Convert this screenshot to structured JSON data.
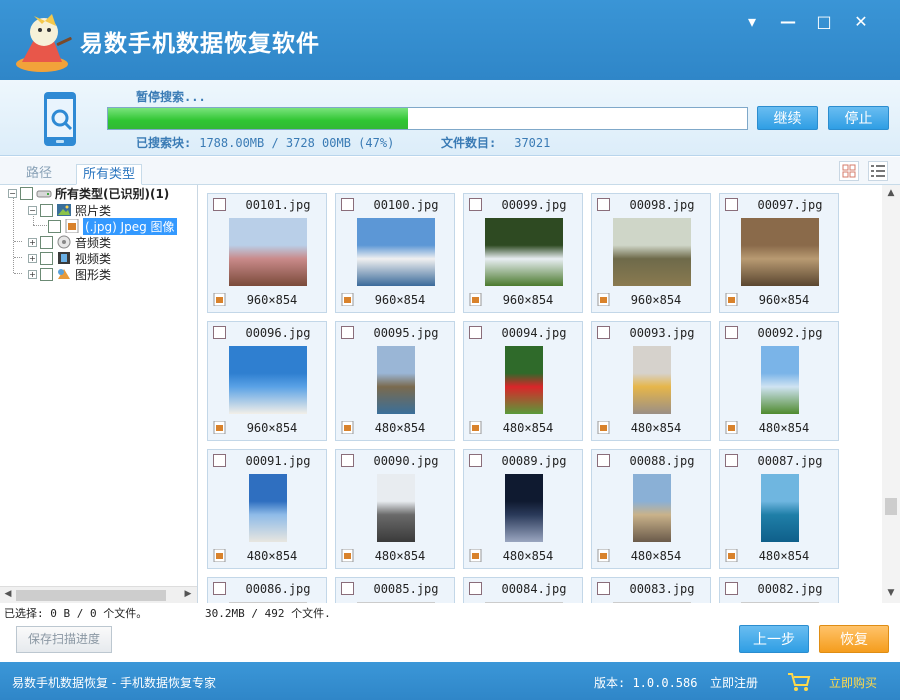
{
  "titlebar": {
    "title": "易数手机数据恢复软件",
    "menu_glyph": "▾",
    "minimize_glyph": "—",
    "maximize_glyph": "□",
    "close_glyph": "✕"
  },
  "progress": {
    "status": "暂停搜索...",
    "percent": 47,
    "resume_label": "继续",
    "stop_label": "停止",
    "searched_label": "已搜索块:",
    "searched_value": "1788.00MB / 3728 00MB (47%)",
    "file_count_label": "文件数目:",
    "file_count_value": "37021"
  },
  "tabs": [
    {
      "label": "路径"
    },
    {
      "label": "所有类型"
    }
  ],
  "tree": {
    "root": "所有类型(已识别)(1)",
    "photos": "照片类",
    "jpeg": "(.jpg) Jpeg 图像",
    "audio": "音频类",
    "video": "视频类",
    "graphics": "图形类"
  },
  "files": [
    {
      "name": "00101.jpg",
      "dim": "960×854",
      "portrait": false,
      "colors": [
        "#b9cfe8",
        "#c98a8a",
        "#7a4a3a"
      ]
    },
    {
      "name": "00100.jpg",
      "dim": "960×854",
      "portrait": false,
      "colors": [
        "#5c97d6",
        "#f0f0f0",
        "#3a6a9a"
      ]
    },
    {
      "name": "00099.jpg",
      "dim": "960×854",
      "portrait": false,
      "colors": [
        "#2e4a22",
        "#e8eef2",
        "#4b7a2e"
      ]
    },
    {
      "name": "00098.jpg",
      "dim": "960×854",
      "portrait": false,
      "colors": [
        "#cfd6c8",
        "#6e6a4a",
        "#8a7a50"
      ]
    },
    {
      "name": "00097.jpg",
      "dim": "960×854",
      "portrait": false,
      "colors": [
        "#8a6a4a",
        "#b89a72",
        "#5a4630"
      ]
    },
    {
      "name": "00096.jpg",
      "dim": "960×854",
      "portrait": false,
      "colors": [
        "#2f7fd0",
        "#5aa2e6",
        "#f2efe8"
      ]
    },
    {
      "name": "00095.jpg",
      "dim": "480×854",
      "portrait": true,
      "colors": [
        "#9ab6d6",
        "#7a6a4e",
        "#3a6f9a"
      ]
    },
    {
      "name": "00094.jpg",
      "dim": "480×854",
      "portrait": true,
      "colors": [
        "#2f6a2a",
        "#d9262a",
        "#5a9a3a"
      ]
    },
    {
      "name": "00093.jpg",
      "dim": "480×854",
      "portrait": true,
      "colors": [
        "#d6d2cc",
        "#e6b64a",
        "#9a8f86"
      ]
    },
    {
      "name": "00092.jpg",
      "dim": "480×854",
      "portrait": true,
      "colors": [
        "#7ab4e8",
        "#cfe3f2",
        "#4f8a2e"
      ]
    },
    {
      "name": "00091.jpg",
      "dim": "480×854",
      "portrait": true,
      "colors": [
        "#2f6fc0",
        "#8fbbe8",
        "#e8e6e0"
      ]
    },
    {
      "name": "00090.jpg",
      "dim": "480×854",
      "portrait": true,
      "colors": [
        "#e8ecf0",
        "#6a6a6a",
        "#3a3a3a"
      ]
    },
    {
      "name": "00089.jpg",
      "dim": "480×854",
      "portrait": true,
      "colors": [
        "#0f1a30",
        "#2a3a5a",
        "#9aa6c0"
      ]
    },
    {
      "name": "00088.jpg",
      "dim": "480×854",
      "portrait": true,
      "colors": [
        "#8ab0d6",
        "#c9b28a",
        "#6a5a4a"
      ]
    },
    {
      "name": "00087.jpg",
      "dim": "480×854",
      "portrait": true,
      "colors": [
        "#6fb6e0",
        "#1f7fa8",
        "#0f5f8a"
      ]
    },
    {
      "name": "00086.jpg",
      "dim": "",
      "portrait": false,
      "colors": [
        "#cccccc",
        "#cccccc",
        "#cccccc"
      ]
    },
    {
      "name": "00085.jpg",
      "dim": "",
      "portrait": false,
      "colors": [
        "#cccccc",
        "#cccccc",
        "#cccccc"
      ]
    },
    {
      "name": "00084.jpg",
      "dim": "",
      "portrait": false,
      "colors": [
        "#cccccc",
        "#cccccc",
        "#cccccc"
      ]
    },
    {
      "name": "00083.jpg",
      "dim": "",
      "portrait": false,
      "colors": [
        "#cccccc",
        "#cccccc",
        "#cccccc"
      ]
    },
    {
      "name": "00082.jpg",
      "dim": "",
      "portrait": false,
      "colors": [
        "#cccccc",
        "#cccccc",
        "#cccccc"
      ]
    }
  ],
  "status": {
    "selected": "已选择: 0 B / 0 个文件。",
    "total": "30.2MB / 492 个文件."
  },
  "buttons": {
    "save_progress": "保存扫描进度",
    "prev": "上一步",
    "recover": "恢复"
  },
  "footer": {
    "left": "易数手机数据恢复 - 手机数据恢复专家",
    "version": "版本: 1.0.0.586",
    "register": "立即注册",
    "buy": "立即购买"
  },
  "colors": {
    "header_blue": "#2f86c8",
    "progress_green": "#2fc532",
    "button_blue": "#2f9ee4",
    "button_orange": "#f59d1d"
  },
  "icons": {
    "tree_root": "drive-icon",
    "photos": "photo-category-icon",
    "audio": "audio-category-icon",
    "video": "video-category-icon",
    "graphics": "graphics-category-icon"
  }
}
